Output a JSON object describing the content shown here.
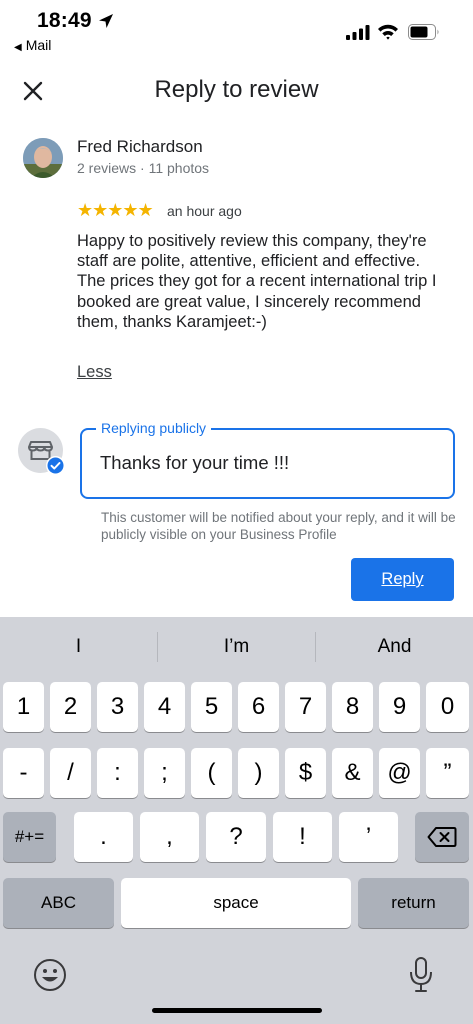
{
  "status": {
    "time": "18:49",
    "back_app": "Mail"
  },
  "header": {
    "title": "Reply to review"
  },
  "review": {
    "reviewer_name": "Fred Richardson",
    "reviewer_meta": "2 reviews · 11 photos",
    "rating": 5,
    "stars": "★★★★★",
    "time": "an hour ago",
    "text": "Happy to positively review this company, they're staff are polite, attentive, efficient and effective. The prices they got for a recent international trip I booked are great value, I sincerely recommend them, thanks Karamjeet:-)",
    "less_label": "Less"
  },
  "reply": {
    "label": "Replying publicly",
    "value": "Thanks for your time !!!",
    "hint": "This customer will be notified about your reply, and it will be publicly visible on your Business Profile",
    "button_label": "Reply"
  },
  "keyboard": {
    "suggestions": [
      "I",
      "I’m",
      "And"
    ],
    "row1": [
      "1",
      "2",
      "3",
      "4",
      "5",
      "6",
      "7",
      "8",
      "9",
      "0"
    ],
    "row2": [
      "-",
      "/",
      ":",
      ";",
      "(",
      ")",
      "$",
      "&",
      "@",
      "”"
    ],
    "row3_mode": "#+=",
    "row3": [
      ".",
      ",",
      "?",
      "!",
      "’"
    ],
    "abc_label": "ABC",
    "space_label": "space",
    "return_label": "return"
  },
  "colors": {
    "accent": "#1a73e8",
    "star": "#f4b400",
    "keyboard_bg": "#d1d3d9"
  },
  "icons": [
    "location-arrow-icon",
    "signal-icon",
    "wifi-icon",
    "battery-icon",
    "close-icon",
    "storefront-icon",
    "verified-check-icon",
    "backspace-icon",
    "emoji-icon",
    "microphone-icon"
  ]
}
